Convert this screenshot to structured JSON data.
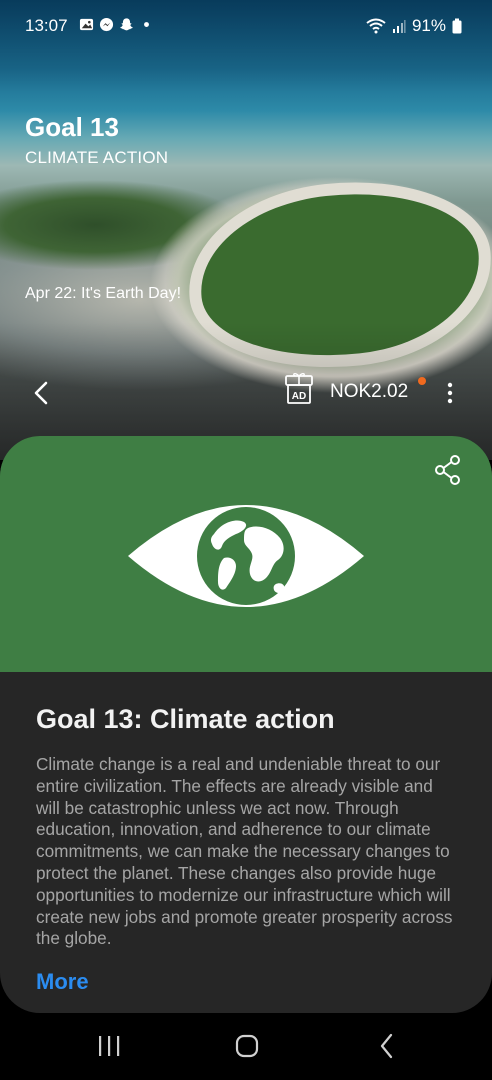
{
  "status_bar": {
    "time": "13:07",
    "left_icons": [
      "gallery-icon",
      "messenger-icon",
      "snapchat-icon",
      "dot-icon"
    ],
    "right_icons": [
      "wifi-icon",
      "signal-icon",
      "battery-icon"
    ],
    "battery": "91%"
  },
  "hero": {
    "title": "Goal 13",
    "subtitle": "CLIMATE ACTION",
    "date_text": "Apr 22: It's Earth Day!",
    "ad_label": "AD",
    "currency_value": "NOK2.02",
    "accent_dot_color": "#f06a1f"
  },
  "card": {
    "green_color": "#3f7e44",
    "title": "Goal 13: Climate action",
    "body": "Climate change is a real and undeniable threat to our entire civilization. The effects are already visible and will be catastrophic unless we act now. Through education, innovation, and adherence to our climate commitments, we can make the necessary changes to protect the planet. These changes also provide huge opportunities to modernize our infrastructure which will create new jobs and promote greater prosperity across the globe.",
    "more_label": "More",
    "more_color": "#2b8cf0"
  },
  "nav_bar": {
    "buttons": [
      "recents-icon",
      "home-icon",
      "back-icon"
    ]
  }
}
